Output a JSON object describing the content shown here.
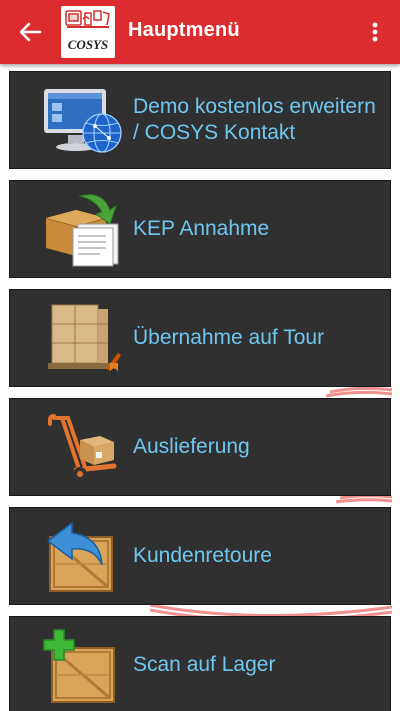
{
  "header": {
    "title": "Hauptmenü",
    "back_icon": "arrow-left-icon",
    "overflow_icon": "more-vert-icon",
    "logo_text": "COSYS",
    "colors": {
      "bar": "#dd2c30",
      "title": "#ffffff"
    }
  },
  "menu": {
    "item_background": "#303030",
    "label_color": "#6fc7f0",
    "items": [
      {
        "label": "Demo kostenlos erweitern / COSYS Kontakt",
        "icon": "monitor-globe-icon"
      },
      {
        "label": "KEP Annahme",
        "icon": "box-document-icon"
      },
      {
        "label": "Übernahme auf Tour",
        "icon": "pallet-jack-icon"
      },
      {
        "label": "Auslieferung",
        "icon": "hand-truck-icon"
      },
      {
        "label": "Kundenretoure",
        "icon": "crate-return-icon"
      },
      {
        "label": "Scan auf Lager",
        "icon": "crate-add-icon"
      }
    ]
  }
}
